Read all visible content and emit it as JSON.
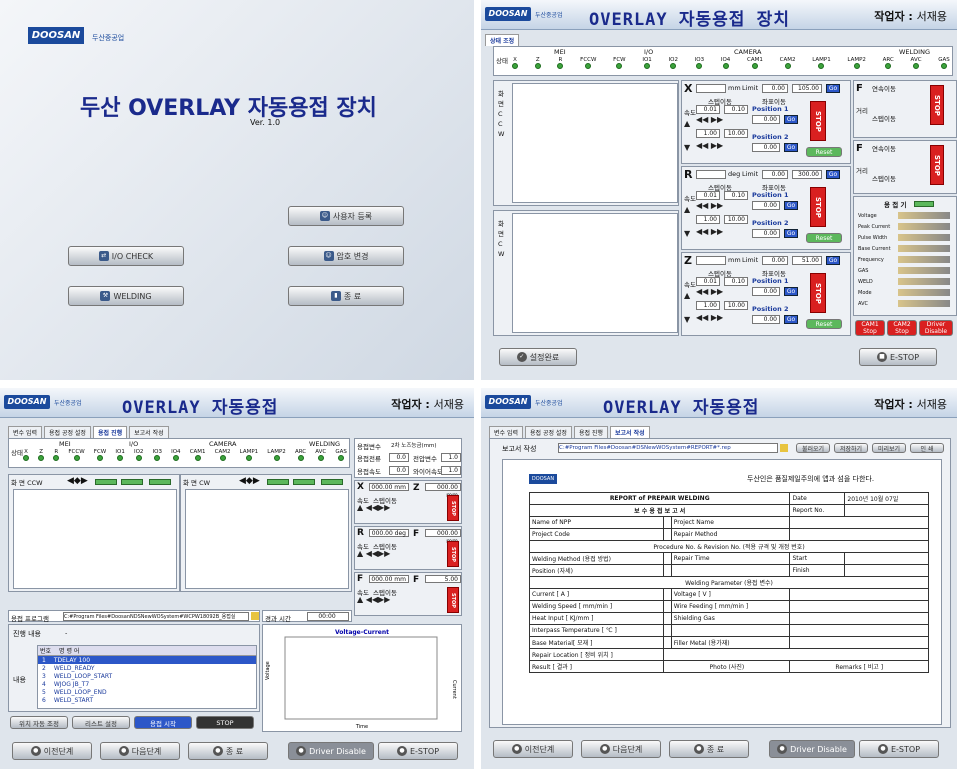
{
  "q1": {
    "logo": "DOOSAN",
    "sub": "두산중공업",
    "title": "두산 OVERLAY 자동용접 장치",
    "ver": "Ver. 1.0",
    "btn_user": "사용자 등록",
    "btn_io": "I/O CHECK",
    "btn_pw": "암호 변경",
    "btn_weld": "WELDING",
    "btn_exit": "종 료"
  },
  "q2": {
    "title": "OVERLAY 자동용접 장치",
    "worker": "작업자 : ",
    "worker_name": "서재용",
    "tab": "상태 조정",
    "state": "상태",
    "groups": [
      "MEI",
      "I/O",
      "CAMERA",
      "WELDING"
    ],
    "cols": [
      "X",
      "Z",
      "R",
      "FCCW",
      "FCW",
      "IO1",
      "IO2",
      "IO3",
      "IO4",
      "CAM1",
      "CAM2",
      "LAMP1",
      "LAMP2",
      "ARC",
      "AVC",
      "GAS"
    ],
    "ccw_label": "화 면 C C W",
    "cw_label": "화 면 C W",
    "axes": [
      {
        "name": "X",
        "unit": "mm",
        "limit": "Limit",
        "lval1": "0.00",
        "lval2": "105.00"
      },
      {
        "name": "R",
        "unit": "deg",
        "limit": "Limit",
        "lval1": "0.00",
        "lval2": "300.00"
      },
      {
        "name": "Z",
        "unit": "mm",
        "limit": "Limit",
        "lval1": "0.00",
        "lval2": "51.00"
      }
    ],
    "step": "스텝이동",
    "coord": "좌표이동",
    "speed": "속도",
    "pos1": "Position 1",
    "pos2": "Position 2",
    "v001": "0.01",
    "v010": "0.10",
    "v100": "1.00",
    "v1000": "10.00",
    "zero": "0.00",
    "go": "Go",
    "reset": "Reset",
    "stop": "STOP",
    "fccw": "F",
    "cont": "연속이동",
    "dist": "거리",
    "stepmv": "스텝이동",
    "welder": "용 접 기",
    "welder_params": [
      "Voltage",
      "Peak Current",
      "Pulse Width",
      "Base Current",
      "Frequency",
      "GAS",
      "WELD",
      "Mode",
      "AVC"
    ],
    "cam1": "CAM1 Stop",
    "cam2": "CAM2 Stop",
    "driver": "Driver Disable",
    "setdone": "설정완료",
    "estop": "E-STOP",
    "on": "ON"
  },
  "q3": {
    "title": "OVERLAY 자동용접",
    "worker": "작업자 : ",
    "worker_name": "서재용",
    "tabs": [
      "변수 입력",
      "용접 공정 설정",
      "용접 진행",
      "보고서 작성"
    ],
    "ccw": "화 면 CCW",
    "cw": "화 면 CW",
    "params": [
      {
        "k": "용접변수",
        "v": "2차 노즈능금(mm)"
      },
      {
        "k": "용접전류",
        "v": "0.0"
      },
      {
        "k": "용접속도",
        "v": "0.0"
      }
    ],
    "params2": [
      {
        "k": "전압변수",
        "v": "1.0"
      },
      {
        "k": "와이어속도",
        "v": "1.0"
      }
    ],
    "program_lbl": "용접 프로그램",
    "program_path": "C:#Program Files#DoosanNDSNewWOSystem#WCPW18092B_용접실",
    "elapsed": "경과 시간",
    "elapsed_v": "00:00",
    "progress_lbl": "진행 내용",
    "progress_v": "-",
    "content": "내용",
    "list_header": [
      "번호",
      "명 령 어"
    ],
    "list": [
      {
        "n": "1",
        "c": "TDELAY 100"
      },
      {
        "n": "2",
        "c": "WELD_READY"
      },
      {
        "n": "3",
        "c": "WELD_LOOP_START"
      },
      {
        "n": "4",
        "c": "WJOG JB_T7"
      },
      {
        "n": "5",
        "c": "WELD_LOOP_END"
      },
      {
        "n": "6",
        "c": "WELD_START"
      }
    ],
    "chart_title": "Voltage-Current",
    "chart_xl": "Time",
    "chart_yl": "Voltage",
    "chart_yr": "Current",
    "b_pos": "위치 자동 조정",
    "b_lst": "리스트 설정",
    "b_start": "용접 시작",
    "b_stop": "STOP",
    "prev": "이전단계",
    "next": "다음단계",
    "exit": "종 료",
    "driver": "Driver Disable",
    "estop": "E-STOP",
    "x": "X",
    "z": "Z",
    "r": "R",
    "f": "F",
    "zmove": "Z Move",
    "zmove_v": "5.00",
    "v0": "000.00 mm",
    "vdeg": "000.00 deg"
  },
  "q4": {
    "title": "OVERLAY 자동용접",
    "worker": "작업자 : ",
    "worker_name": "서재용",
    "tabs": [
      "변수 입력",
      "용접 공정 설정",
      "용접 진행",
      "보고서 작성"
    ],
    "rep_lbl": "보고서 작성",
    "rep_path": "C:#Program Files#Doosan#DSNewWOSystem#REPORT#*.rep",
    "b1": "불러오기",
    "b2": "저장하기",
    "b3": "미리보기",
    "b4": "인 쇄",
    "head": "두산인은 품질제일주의에 앱과 섬을 다한다.",
    "r_title": "REPORT of PREPAIR WELDING",
    "r_sub": "보 수 용 접 보 고 서",
    "date_lbl": "Date",
    "date_v": "2010년 10월 07일",
    "repno": "Report No.",
    "rows": [
      "Name of NPP",
      "Project Name",
      "Project Code",
      "Repair Method",
      "Procedure No. & Revision No. (적용 규격 및 개정 번호)",
      "Welding Method (용접 방법)",
      "Repair Time",
      "Start",
      "Position (자세)",
      "Finish",
      "Welding Parameter (용접 변수)",
      "Current [ A ]",
      "Voltage [ V ]",
      "Welding Speed [ mm/min ]",
      "Wire Feeding [ mm/min ]",
      "Heat Input [ KJ/mm ]",
      "Shielding Gas",
      "Interpass Temperature [ ℃ ]",
      "Base Material[ 모재 ]",
      "Filler Metal (용가재)",
      "Repair Location [ 정비 위치 ]",
      "Result [ 결과 ]",
      "Photo (사진)",
      "Remarks [ 비고 ]"
    ],
    "prev": "이전단계",
    "next": "다음단계",
    "exit": "종 료",
    "driver": "Driver Disable",
    "estop": "E-STOP"
  }
}
